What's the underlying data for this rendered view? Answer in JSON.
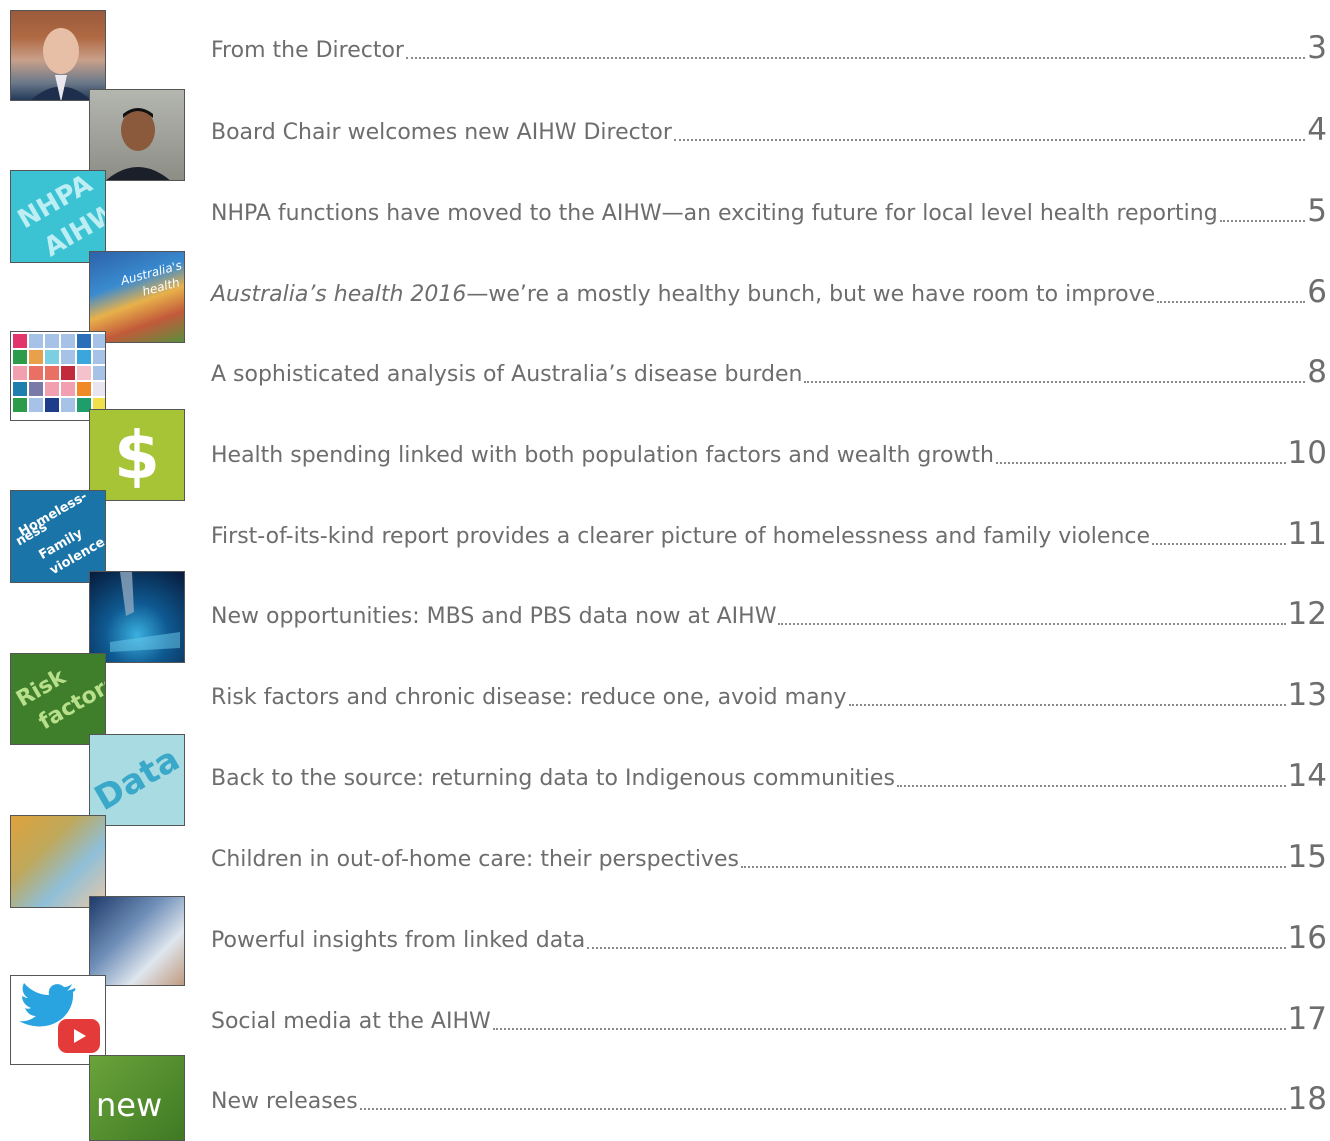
{
  "toc": [
    {
      "title": "From the Director",
      "page": "3"
    },
    {
      "title": "Board Chair welcomes new AIHW Director",
      "page": "4"
    },
    {
      "title": "NHPA functions have moved to the AIHW—an exciting future for local level health reporting",
      "page": "5"
    },
    {
      "title_italic": "Australia’s health 2016",
      "title": "—we’re a mostly healthy bunch, but we have room to improve",
      "page": "6"
    },
    {
      "title": "A sophisticated analysis of Australia’s disease burden",
      "page": "8"
    },
    {
      "title": "Health spending linked with both population factors and wealth growth",
      "page": "10"
    },
    {
      "title": "First-of-its-kind report provides a clearer picture of homelessness and family violence",
      "page": "11"
    },
    {
      "title": "New opportunities: MBS and PBS data now at AIHW",
      "page": "12"
    },
    {
      "title": "Risk factors and chronic disease: reduce one, avoid many",
      "page": "13"
    },
    {
      "title": "Back to the source: returning data to Indigenous communities",
      "page": "14"
    },
    {
      "title": "Children in out-of-home care: their perspectives",
      "page": "15"
    },
    {
      "title": "Powerful insights from linked data",
      "page": "16"
    },
    {
      "title": "Social media at the AIHW",
      "page": "17"
    },
    {
      "title": "New releases",
      "page": "18"
    }
  ],
  "thumbnails": {
    "nhpa_1": "NHPA",
    "nhpa_2": "AIHW",
    "aus_health_1": "Australia's",
    "aus_health_2": "health",
    "dollar": "$",
    "homeless_1": "Homeless-",
    "homeless_2": "ness",
    "homeless_3": "Family",
    "homeless_4": "violence",
    "risk_1": "Risk",
    "risk_2": "factors",
    "data": "Data",
    "new": "new"
  },
  "icons": [
    "director-photo",
    "board-chair-photo",
    "nhpa-aihw-tile",
    "australias-health-tile",
    "disease-burden-mosaic",
    "dollar-icon",
    "homelessness-tile",
    "data-touch-photo",
    "risk-factors-tile",
    "data-tile",
    "children-photo",
    "linked-data-photo",
    "twitter-icon",
    "youtube-icon",
    "new-releases-tile"
  ],
  "colors": {
    "text": "#6d6d6d",
    "leader": "#8a8a8a",
    "nhpa": "#3cc3d3",
    "dollar": "#a7c437",
    "homeless": "#1b74a8",
    "risk": "#3f7f2c",
    "data": "#a9dbe3",
    "new": "#4e8a2f"
  }
}
